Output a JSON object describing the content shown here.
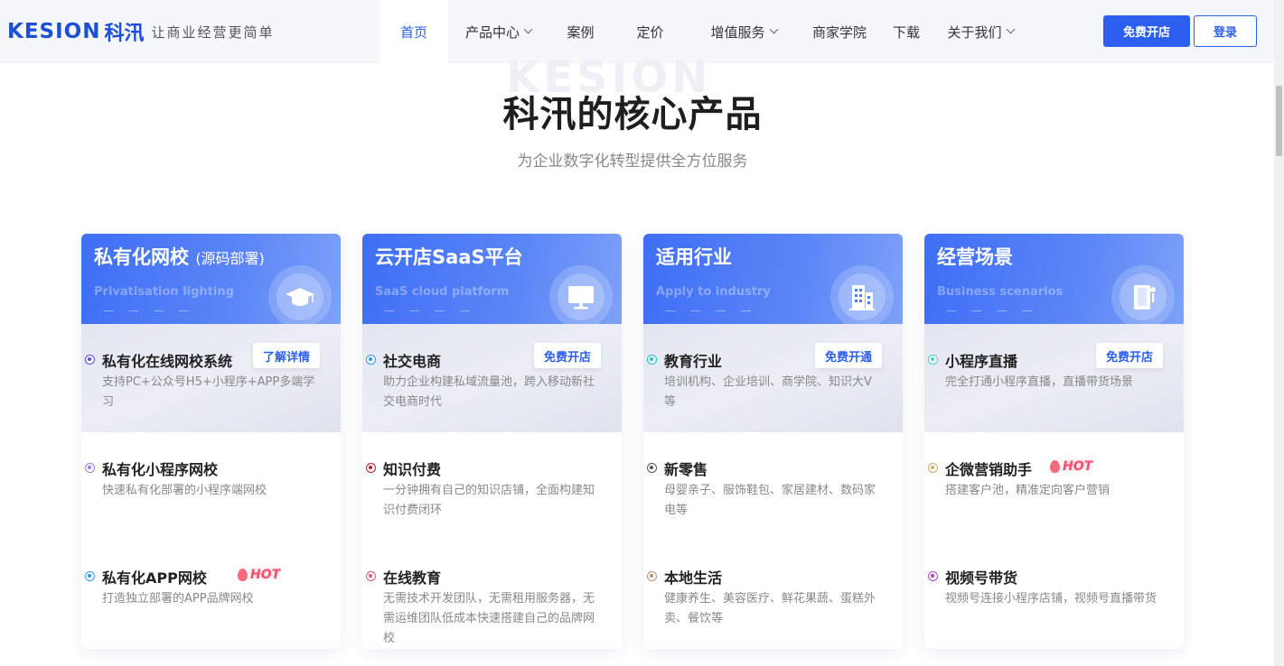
{
  "header": {
    "logo_word": "KESION",
    "logo_cn": "科汛",
    "slogan": "让商业经营更简单",
    "nav": [
      {
        "label": "首页",
        "active": true,
        "dropdown": false
      },
      {
        "label": "产品中心",
        "active": false,
        "dropdown": true
      },
      {
        "label": "案例",
        "active": false,
        "dropdown": false
      },
      {
        "label": "定价",
        "active": false,
        "dropdown": false
      },
      {
        "label": "增值服务",
        "active": false,
        "dropdown": true
      },
      {
        "label": "商家学院",
        "active": false,
        "dropdown": false
      },
      {
        "label": "下载",
        "active": false,
        "dropdown": false
      },
      {
        "label": "关于我们",
        "active": false,
        "dropdown": true
      }
    ],
    "open_store_label": "免费开店",
    "login_label": "登录"
  },
  "section": {
    "watermark": "KESION",
    "title": "科汛的核心产品",
    "subtitle": "为企业数字化转型提供全方位服务"
  },
  "hot_label": "HOT",
  "colors": {
    "primary": "#2c5ef0",
    "hot": "#f0506e"
  },
  "cards": [
    {
      "title": "私有化网校",
      "title_suffix": "(源码部署)",
      "en": "Privatisation lighting",
      "dashes": "— — — —",
      "icon": "graduation-cap-icon",
      "items": [
        {
          "title": "私有化在线网校系统",
          "desc": "支持PC+公众号H5+小程序+APP多端学习",
          "button": "了解详情",
          "dot": "#5b4fd6",
          "hot": false
        },
        {
          "title": "私有化小程序网校",
          "desc": "快速私有化部署的小程序端网校",
          "dot": "#9b7fe6",
          "hot": false
        },
        {
          "title": "私有化APP网校",
          "desc": "打造独立部署的APP品牌网校",
          "dot": "#2f9be8",
          "hot": true
        }
      ]
    },
    {
      "title": "云开店SaaS平台",
      "en": "SaaS cloud platform",
      "dashes": "— — — —",
      "icon": "monitor-icon",
      "items": [
        {
          "title": "社交电商",
          "desc": "助力企业构建私域流量池，跨入移动新社交电商时代",
          "button": "免费开店",
          "dot": "#2f9be8",
          "hot": false
        },
        {
          "title": "知识付费",
          "desc": "一分钟拥有自己的知识店铺，全面构建知识付费闭环",
          "dot": "#b01c2e",
          "hot": false
        },
        {
          "title": "在线教育",
          "desc": "无需技术开发团队，无需租用服务器，无需运维团队低成本快速搭建自己的品牌网校",
          "dot": "#e8566f",
          "hot": false
        }
      ]
    },
    {
      "title": "适用行业",
      "en": "Apply to industry",
      "dashes": "— — — —",
      "icon": "building-icon",
      "items": [
        {
          "title": "教育行业",
          "desc": "培训机构、企业培训、商学院、知识大V等",
          "button": "免费开通",
          "dot": "#1fc0c6",
          "hot": false
        },
        {
          "title": "新零售",
          "desc": "母婴亲子、服饰鞋包、家居建材、数码家电等",
          "dot": "#555555",
          "hot": false
        },
        {
          "title": "本地生活",
          "desc": "健康养生、美容医疗、鲜花果蔬、蛋糕外卖、餐饮等",
          "dot": "#b89277",
          "hot": false
        }
      ]
    },
    {
      "title": "经营场景",
      "en": "Business scenarios",
      "dashes": "— — — —",
      "icon": "mobile-info-icon",
      "items": [
        {
          "title": "小程序直播",
          "desc": "完全打通小程序直播，直播带货场景",
          "button": "免费开店",
          "dot": "#3fd3cf",
          "hot": false
        },
        {
          "title": "企微营销助手",
          "desc": "搭建客户池，精准定向客户营销",
          "dot": "#c8b06a",
          "hot": true
        },
        {
          "title": "视频号带货",
          "desc": "视频号连接小程序店铺，视频号直播带货",
          "dot": "#b23fc9",
          "hot": false
        }
      ]
    }
  ]
}
